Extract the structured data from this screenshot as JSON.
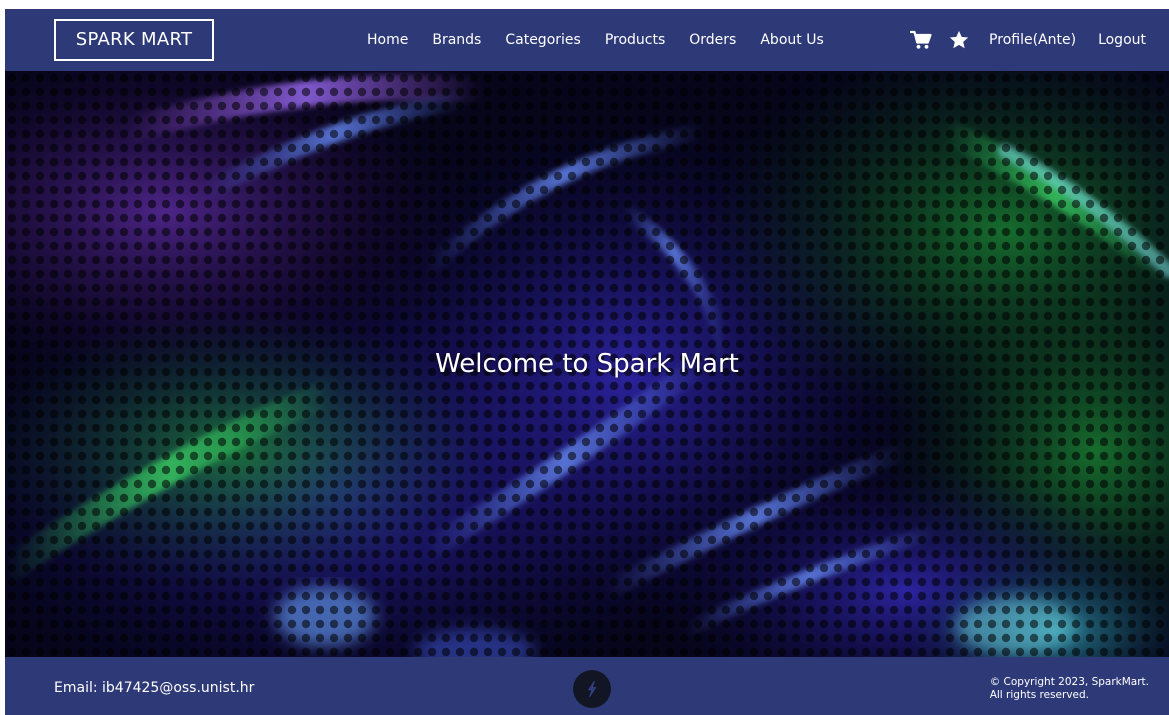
{
  "brand": {
    "name": "SPARK MART"
  },
  "nav": {
    "links": [
      "Home",
      "Brands",
      "Categories",
      "Products",
      "Orders",
      "About Us"
    ],
    "cart_icon": "cart-icon",
    "favorites_icon": "star-icon",
    "profile": "Profile(Ante)",
    "logout": "Logout"
  },
  "hero": {
    "title": "Welcome to Spark Mart"
  },
  "footer": {
    "email": "Email: ib47425@oss.unist.hr",
    "logo_icon": "lightning-bolt-icon",
    "copyright_line1": "© Copyright 2023, SparkMart.",
    "copyright_line2": "All rights reserved."
  },
  "colors": {
    "navbar": "#2e3a78",
    "text": "#ffffff",
    "footer_logo_bg": "#121524"
  }
}
